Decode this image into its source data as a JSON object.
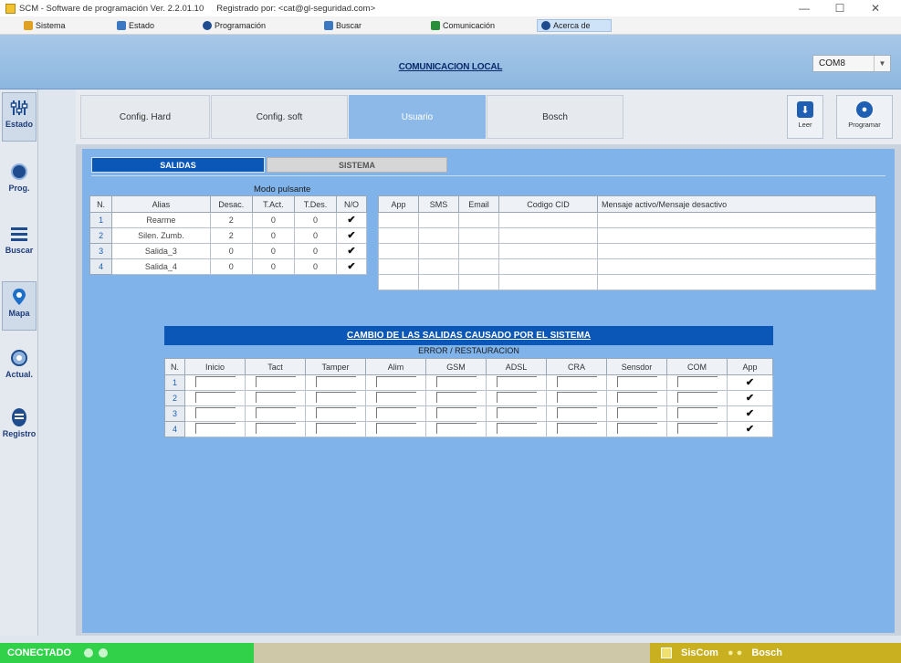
{
  "window": {
    "title": "SCM - Software de programación Ver. 2.2.01.10",
    "registered": "Registrado por: <cat@gl-seguridad.com>",
    "controls": [
      "—",
      "☐",
      "✕"
    ]
  },
  "menu": {
    "items": [
      {
        "label": "Sistema",
        "icon": "sistema-icon"
      },
      {
        "label": "Estado",
        "icon": "estado-icon"
      },
      {
        "label": "Programación",
        "icon": "programacion-icon"
      },
      {
        "label": "Buscar",
        "icon": "buscar-icon"
      },
      {
        "label": "Comunicación",
        "icon": "comunicacion-icon"
      },
      {
        "label": "Acerca de",
        "icon": "acerca-icon"
      }
    ]
  },
  "header": {
    "title": "COMUNICACION LOCAL",
    "com_port": "COM8"
  },
  "sidebar": {
    "items": [
      {
        "label": "Estado",
        "icon": "sliders-icon"
      },
      {
        "label": "Prog.",
        "icon": "prog-icon"
      },
      {
        "label": "Buscar",
        "icon": "list-icon"
      },
      {
        "label": "Mapa",
        "icon": "map-pin-icon"
      },
      {
        "label": "Actual.",
        "icon": "update-icon"
      },
      {
        "label": "Registro",
        "icon": "registro-icon"
      }
    ]
  },
  "tabs": {
    "items": [
      "Config. Hard",
      "Config. soft",
      "Usuario",
      "Bosch"
    ],
    "active": "Usuario"
  },
  "toolbar": {
    "leer": "Leer",
    "programar": "Programar"
  },
  "subtabs": {
    "salidas": "SALIDAS",
    "sistema": "SISTEMA"
  },
  "salidas_table": {
    "modo_label": "Modo pulsante",
    "headers": [
      "N.",
      "Alias",
      "Desac.",
      "T.Act.",
      "T.Des.",
      "N/O"
    ],
    "rows": [
      {
        "n": "1",
        "alias": "Rearme",
        "desac": "2",
        "tact": "0",
        "tdes": "0",
        "no": "✔"
      },
      {
        "n": "2",
        "alias": "Silen. Zumb.",
        "desac": "2",
        "tact": "0",
        "tdes": "0",
        "no": "✔"
      },
      {
        "n": "3",
        "alias": "Salida_3",
        "desac": "0",
        "tact": "0",
        "tdes": "0",
        "no": "✔"
      },
      {
        "n": "4",
        "alias": "Salida_4",
        "desac": "0",
        "tact": "0",
        "tdes": "0",
        "no": "✔"
      }
    ]
  },
  "notif_table": {
    "headers": [
      "App",
      "SMS",
      "Email",
      "Codigo CID",
      "Mensaje activo/Mensaje desactivo"
    ]
  },
  "cambio": {
    "title": "CAMBIO DE LAS SALIDAS CAUSADO POR EL SISTEMA",
    "subtitle": "ERROR / RESTAURACION",
    "headers": [
      "N.",
      "Inicio",
      "Tact",
      "Tamper",
      "Alim",
      "GSM",
      "ADSL",
      "CRA",
      "Sensdor",
      "COM",
      "App"
    ],
    "rows": [
      "1",
      "2",
      "3",
      "4"
    ],
    "app_check": "✔"
  },
  "status": {
    "connection": "CONECTADO",
    "brand_left": "SisCom",
    "brand_right": "Bosch"
  }
}
